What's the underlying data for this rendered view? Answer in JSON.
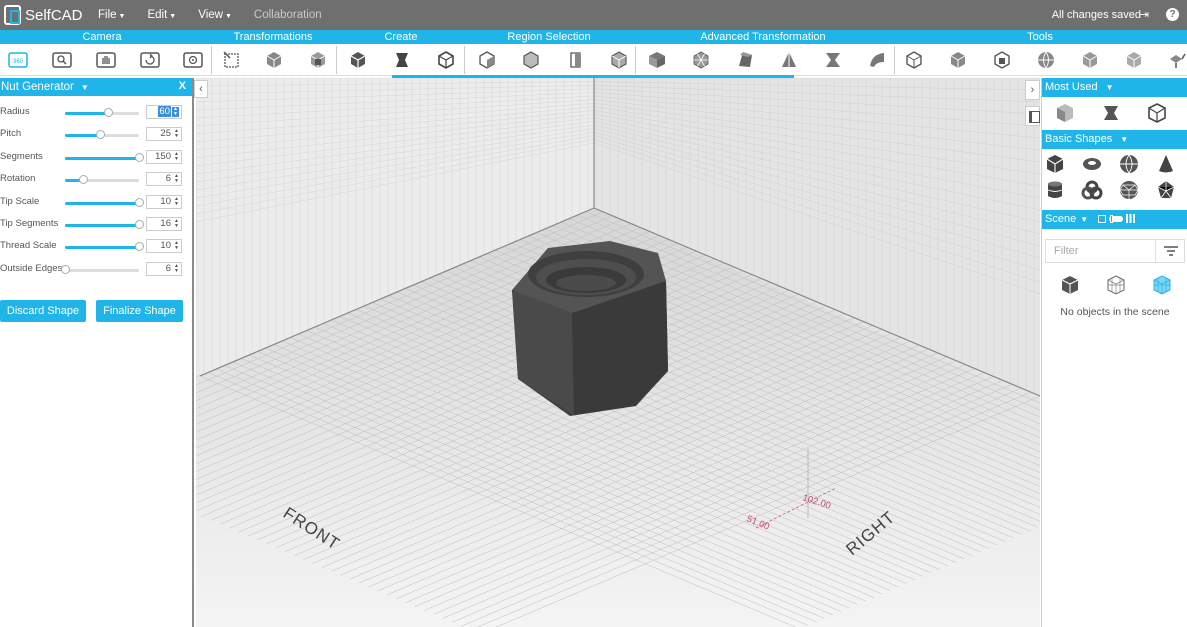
{
  "app": {
    "name": "SelfCAD",
    "status": "All changes saved"
  },
  "menu": [
    {
      "label": "File",
      "has_caret": true
    },
    {
      "label": "Edit",
      "has_caret": true
    },
    {
      "label": "View",
      "has_caret": true
    },
    {
      "label": "Collaboration",
      "has_caret": false
    }
  ],
  "categories": [
    "Camera",
    "Transformations",
    "Create",
    "Region Selection",
    "Advanced Transformation",
    "Tools"
  ],
  "toolbar": {
    "active_tool_label": "360"
  },
  "generator": {
    "title": "Nut Generator",
    "close_label": "X",
    "params": [
      {
        "label": "Radius",
        "value": "60",
        "level": 0.58
      },
      {
        "label": "Pitch",
        "value": "25",
        "level": 0.47
      },
      {
        "label": "Segments",
        "value": "150",
        "level": 1.0
      },
      {
        "label": "Rotation",
        "value": "6",
        "level": 0.24
      },
      {
        "label": "Tip Scale",
        "value": "10",
        "level": 1.0
      },
      {
        "label": "Tip Segments",
        "value": "16",
        "level": 1.0
      },
      {
        "label": "Thread Scale",
        "value": "10",
        "level": 1.0
      },
      {
        "label": "Outside Edges",
        "value": "6",
        "level": 0.0
      }
    ],
    "discard_label": "Discard Shape",
    "finalize_label": "Finalize Shape"
  },
  "viewport": {
    "front_label": "FRONT",
    "right_label": "RIGHT",
    "measure_1": "102.00",
    "measure_2": "51.00"
  },
  "right_panel": {
    "most_used_title": "Most Used",
    "basic_shapes_title": "Basic Shapes",
    "scene_title": "Scene",
    "filter_placeholder": "Filter",
    "empty_message": "No objects in the scene"
  },
  "colors": {
    "accent": "#1fb5e8",
    "topbar": "#6f6f6f",
    "measure": "#c0506e"
  }
}
